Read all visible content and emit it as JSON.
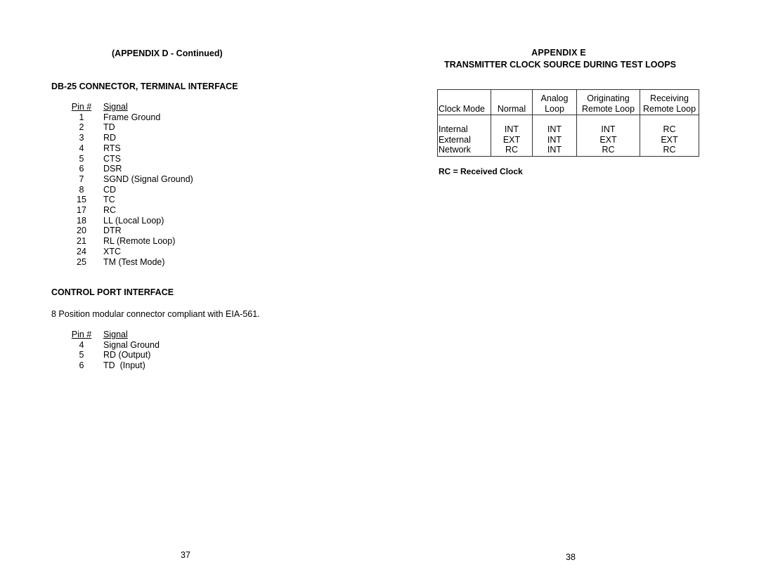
{
  "left_page": {
    "title": "(APPENDIX D - Continued)",
    "db25": {
      "heading": "DB-25 CONNECTOR, TERMINAL INTERFACE",
      "col_pin": "Pin #",
      "col_signal": "Signal",
      "rows": [
        {
          "pin": "1",
          "signal": "Frame Ground"
        },
        {
          "pin": "2",
          "signal": "TD"
        },
        {
          "pin": "3",
          "signal": "RD"
        },
        {
          "pin": "4",
          "signal": "RTS"
        },
        {
          "pin": "5",
          "signal": "CTS"
        },
        {
          "pin": "6",
          "signal": "DSR"
        },
        {
          "pin": "7",
          "signal": "SGND (Signal Ground)"
        },
        {
          "pin": "8",
          "signal": "CD"
        },
        {
          "pin": "15",
          "signal": "TC"
        },
        {
          "pin": "17",
          "signal": "RC"
        },
        {
          "pin": "18",
          "signal": "LL (Local Loop)"
        },
        {
          "pin": "20",
          "signal": "DTR"
        },
        {
          "pin": "21",
          "signal": "RL (Remote Loop)"
        },
        {
          "pin": "24",
          "signal": "XTC"
        },
        {
          "pin": "25",
          "signal": "TM (Test Mode)"
        }
      ]
    },
    "control_port": {
      "heading": "CONTROL PORT INTERFACE",
      "description": "8 Position modular connector compliant with EIA-561.",
      "col_pin": "Pin #",
      "col_signal": "Signal",
      "rows": [
        {
          "pin": "4",
          "signal": "Signal Ground"
        },
        {
          "pin": "5",
          "signal": "RD (Output)"
        },
        {
          "pin": "6",
          "signal": "TD  (Input)"
        }
      ]
    },
    "page_number": "37"
  },
  "right_page": {
    "title": "APPENDIX E",
    "subtitle": "TRANSMITTER CLOCK SOURCE DURING TEST LOOPS",
    "clock_table": {
      "headers": [
        {
          "line1": "",
          "line2": "Clock Mode"
        },
        {
          "line1": "",
          "line2": "Normal"
        },
        {
          "line1": "Analog",
          "line2": "Loop"
        },
        {
          "line1": "Originating",
          "line2": "Remote Loop"
        },
        {
          "line1": "Receiving",
          "line2": "Remote Loop"
        }
      ],
      "columns": [
        [
          "Internal",
          "External",
          "Network"
        ],
        [
          "INT",
          "EXT",
          "RC"
        ],
        [
          "INT",
          "INT",
          "INT"
        ],
        [
          "INT",
          "EXT",
          "RC"
        ],
        [
          "RC",
          "EXT",
          "RC"
        ]
      ]
    },
    "legend": "RC = Received Clock",
    "page_number": "38"
  }
}
